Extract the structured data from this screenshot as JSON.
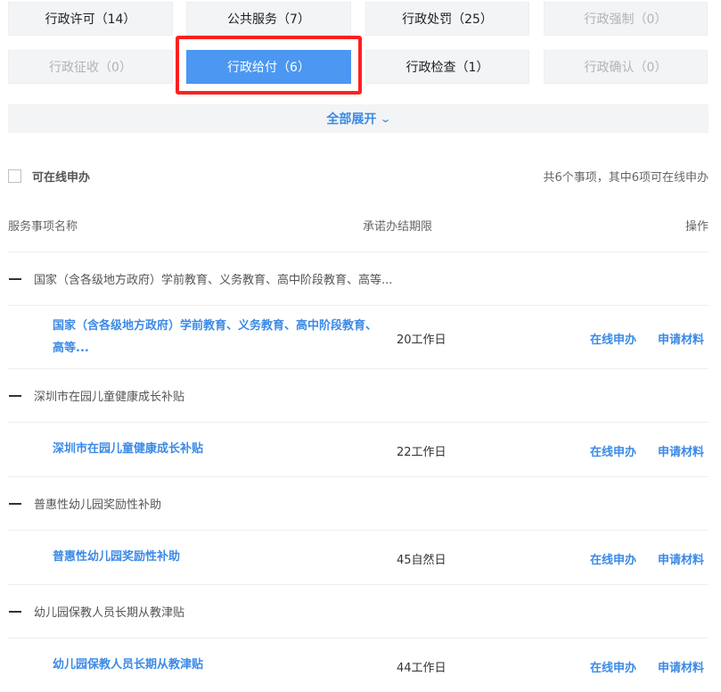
{
  "categories": [
    {
      "label": "行政许可（14）",
      "state": "normal"
    },
    {
      "label": "公共服务（7）",
      "state": "normal"
    },
    {
      "label": "行政处罚（25）",
      "state": "normal"
    },
    {
      "label": "行政强制（0）",
      "state": "disabled"
    },
    {
      "label": "行政征收（0）",
      "state": "disabled"
    },
    {
      "label": "行政给付（6）",
      "state": "active"
    },
    {
      "label": "行政检查（1）",
      "state": "normal"
    },
    {
      "label": "行政确认（0）",
      "state": "disabled"
    }
  ],
  "expand": {
    "label": "全部展开"
  },
  "filter": {
    "online_label": "可在线申办",
    "summary": "共6个事项，其中6项可在线申办"
  },
  "table_header": {
    "name": "服务事项名称",
    "limit": "承诺办结期限",
    "operation": "操作"
  },
  "groups": [
    {
      "title": "国家（含各级地方政府）学前教育、义务教育、高中阶段教育、高等...",
      "item": {
        "name": "国家（含各级地方政府）学前教育、义务教育、高中阶段教育、高等...",
        "limit": "20工作日",
        "op1": "在线申办",
        "op2": "申请材料"
      }
    },
    {
      "title": "深圳市在园儿童健康成长补贴",
      "item": {
        "name": "深圳市在园儿童健康成长补贴",
        "limit": "22工作日",
        "op1": "在线申办",
        "op2": "申请材料"
      }
    },
    {
      "title": "普惠性幼儿园奖励性补助",
      "item": {
        "name": "普惠性幼儿园奖励性补助",
        "limit": "45自然日",
        "op1": "在线申办",
        "op2": "申请材料"
      }
    },
    {
      "title": "幼儿园保教人员长期从教津贴",
      "item": {
        "name": "幼儿园保教人员长期从教津贴",
        "limit": "44工作日",
        "op1": "在线申办",
        "op2": "申请材料"
      }
    }
  ],
  "colors": {
    "accent": "#4b97f2",
    "link": "#3b8ae6",
    "highlight": "#ff2020"
  }
}
